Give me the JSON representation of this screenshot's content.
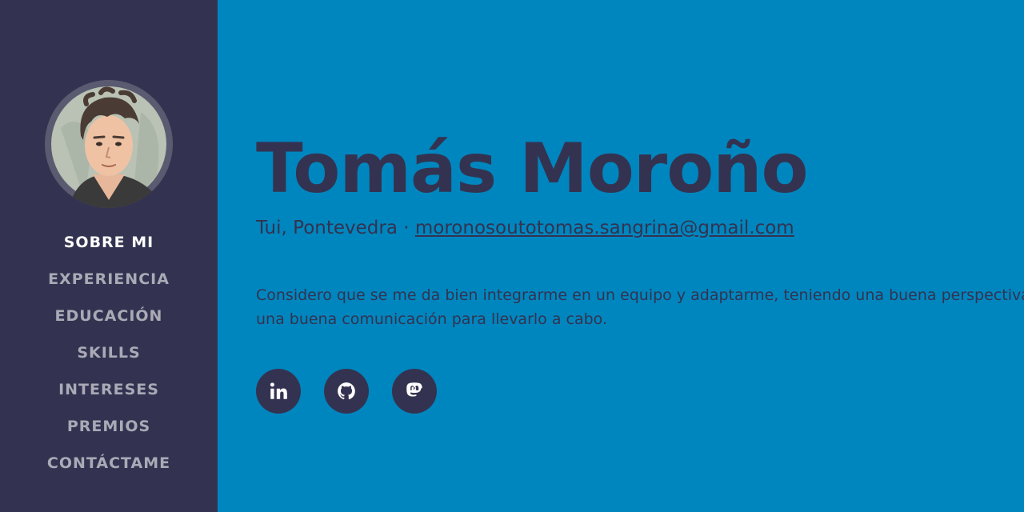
{
  "profile": {
    "first_name": "Tomás",
    "last_name": "Moroño",
    "location": "Tui, Pontevedra",
    "separator": "·",
    "email": "morono­soutotomas.sangrina@gmail.com",
    "bio_line1": "Considero que se me da bien integrarme en un equipo y adaptarme, teniendo una buena perspectiva de",
    "bio_line2": "una buena comunicación para llevarlo a cabo."
  },
  "sidebar": {
    "items": [
      {
        "label": "SOBRE MI",
        "active": true
      },
      {
        "label": "EXPERIENCIA",
        "active": false
      },
      {
        "label": "EDUCACIÓN",
        "active": false
      },
      {
        "label": "SKILLS",
        "active": false
      },
      {
        "label": "INTERESES",
        "active": false
      },
      {
        "label": "PREMIOS",
        "active": false
      },
      {
        "label": "CONTÁCTAME",
        "active": false
      }
    ]
  },
  "social": [
    {
      "name": "linkedin-icon"
    },
    {
      "name": "github-icon"
    },
    {
      "name": "mastodon-icon"
    }
  ],
  "colors": {
    "sidebar_bg": "#333351",
    "main_bg": "#0086be",
    "text_dark": "#333351",
    "nav_inactive": "#aaaab7",
    "nav_active": "#ffffff"
  }
}
